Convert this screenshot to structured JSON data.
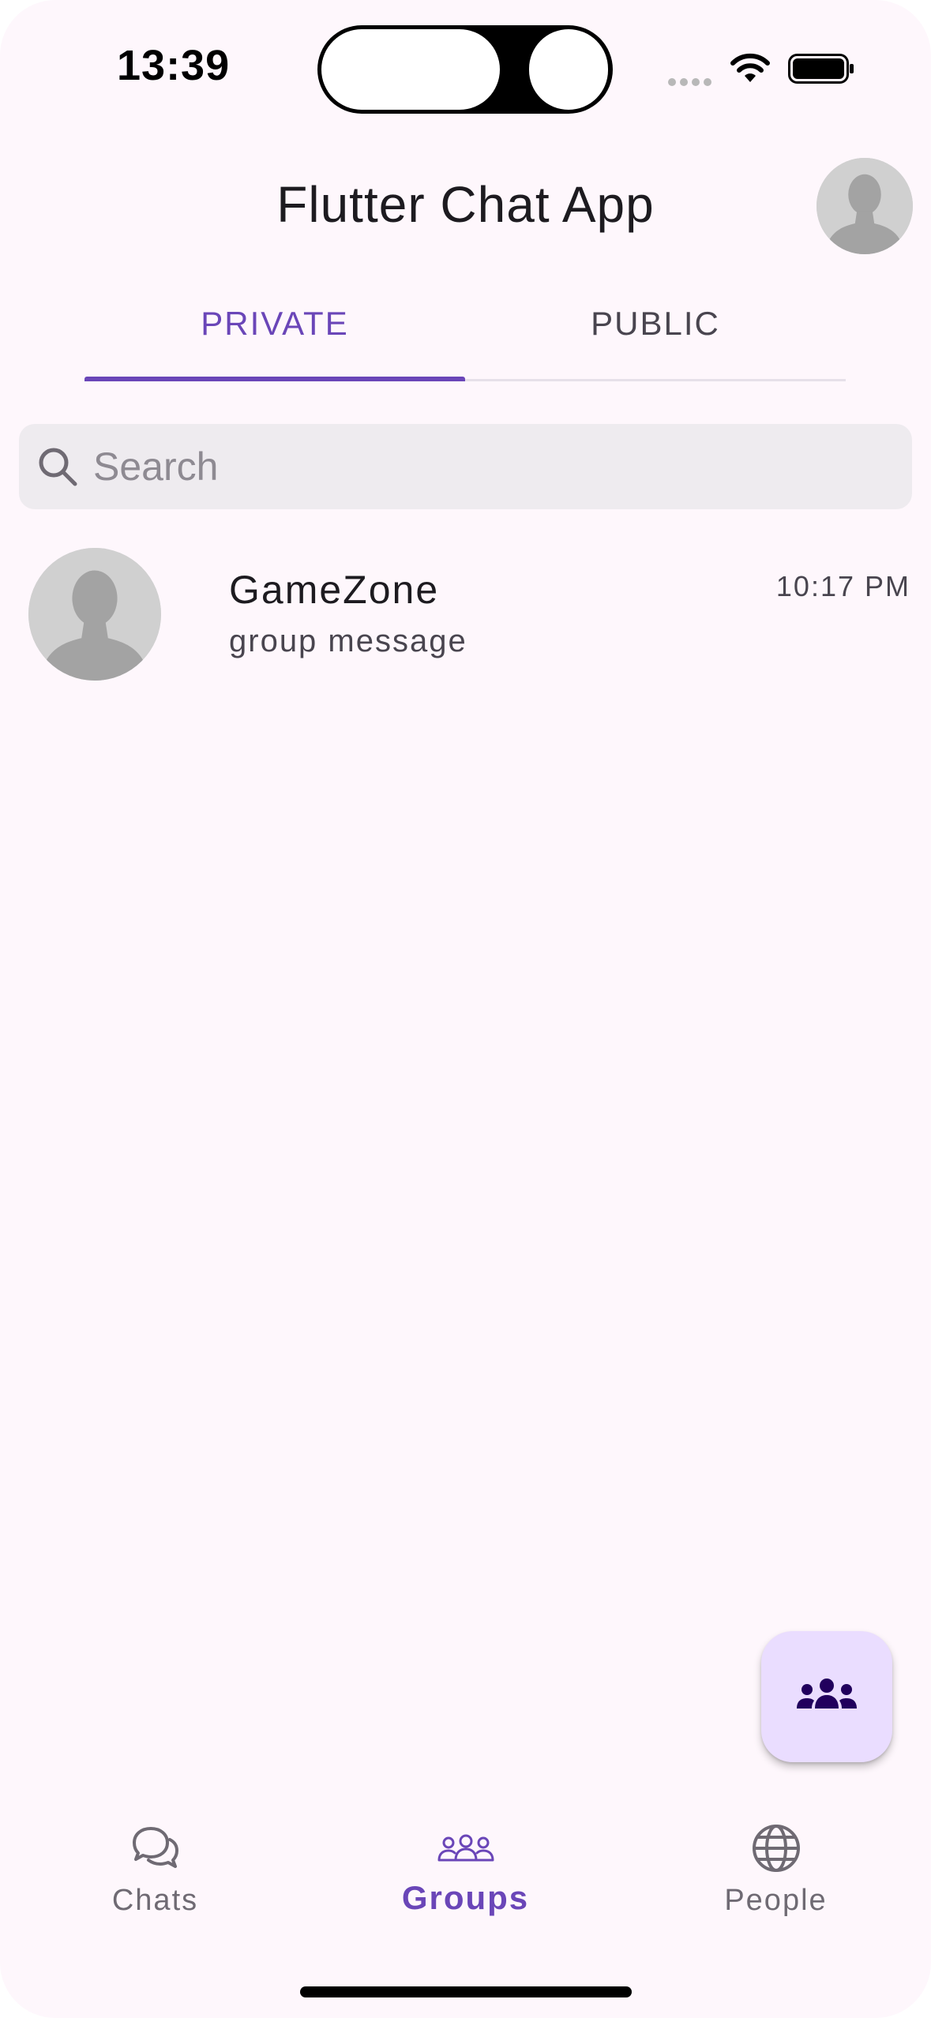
{
  "status_bar": {
    "time": "13:39"
  },
  "app_bar": {
    "title": "Flutter Chat App",
    "profile_icon": "default-avatar-icon"
  },
  "tabs": [
    {
      "label": "PRIVATE",
      "selected": true
    },
    {
      "label": "PUBLIC",
      "selected": false
    }
  ],
  "search": {
    "placeholder": "Search",
    "value": ""
  },
  "groups": [
    {
      "name": "GameZone",
      "last_message": "group message",
      "time": "10:17 PM",
      "avatar_icon": "default-avatar-icon"
    }
  ],
  "fab": {
    "icon": "groups-icon"
  },
  "bottom_nav": {
    "items": [
      {
        "label": "Chats",
        "icon": "chat-bubbles-icon",
        "selected": false
      },
      {
        "label": "Groups",
        "icon": "groups-outline-icon",
        "selected": true
      },
      {
        "label": "People",
        "icon": "globe-icon",
        "selected": false
      }
    ]
  },
  "colors": {
    "background": "#fef7fc",
    "accent": "#6a46b8",
    "fab_background": "#eaddff",
    "search_background": "#eeebef"
  }
}
